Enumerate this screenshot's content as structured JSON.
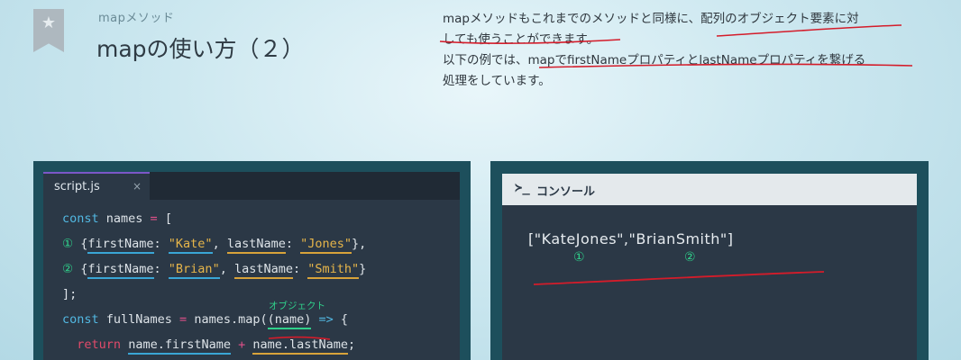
{
  "header": {
    "subtitle": "mapメソッド",
    "title": "mapの使い方（２）",
    "description_lines": [
      "mapメソッドもこれまでのメソッドと同様に、配列のオブジェクト要素に対",
      "しても使うことができます。",
      "以下の例では、mapでfirstNameプロパティとlastNameプロパティを繋げる",
      "処理をしています。"
    ]
  },
  "editor": {
    "tab_name": "script.js",
    "tab_close": "×",
    "code": {
      "l1": {
        "kw": "const",
        "var": " names ",
        "op": "=",
        "rest": " ["
      },
      "l2": {
        "marker": "①",
        "open": " {",
        "key1": "firstName",
        "colon1": ": ",
        "val1": "\"Kate\"",
        "sep": ", ",
        "key2": "lastName",
        "colon2": ": ",
        "val2": "\"Jones\"",
        "close": "},"
      },
      "l3": {
        "marker": "②",
        "open": " {",
        "key1": "firstName",
        "colon1": ": ",
        "val1": "\"Brian\"",
        "sep": ", ",
        "key2": "lastName",
        "colon2": ": ",
        "val2": "\"Smith\"",
        "close": "}"
      },
      "l4": "];",
      "l5": {
        "kw": "const",
        "var": " fullNames ",
        "op": "=",
        "call": " names.map(",
        "param": "(name)",
        "arrow": " => ",
        "brace": "{"
      },
      "l6": {
        "ret": "return",
        "a": "name.firstName",
        "plus": " + ",
        "b": "name.lastName",
        "semi": ";"
      }
    },
    "annotation_label": "オブジェクト"
  },
  "console": {
    "prompt_symbol": "≻_",
    "title": "コンソール",
    "output": "[\"KateJones\",\"BrianSmith\"]",
    "marker1": "①",
    "marker2": "②"
  },
  "colors": {
    "keyword": "#52b8e2",
    "operator": "#e0508a",
    "string": "#e6b54a",
    "annotation_green": "#2fd18b",
    "annotation_red": "#d41c2a"
  }
}
